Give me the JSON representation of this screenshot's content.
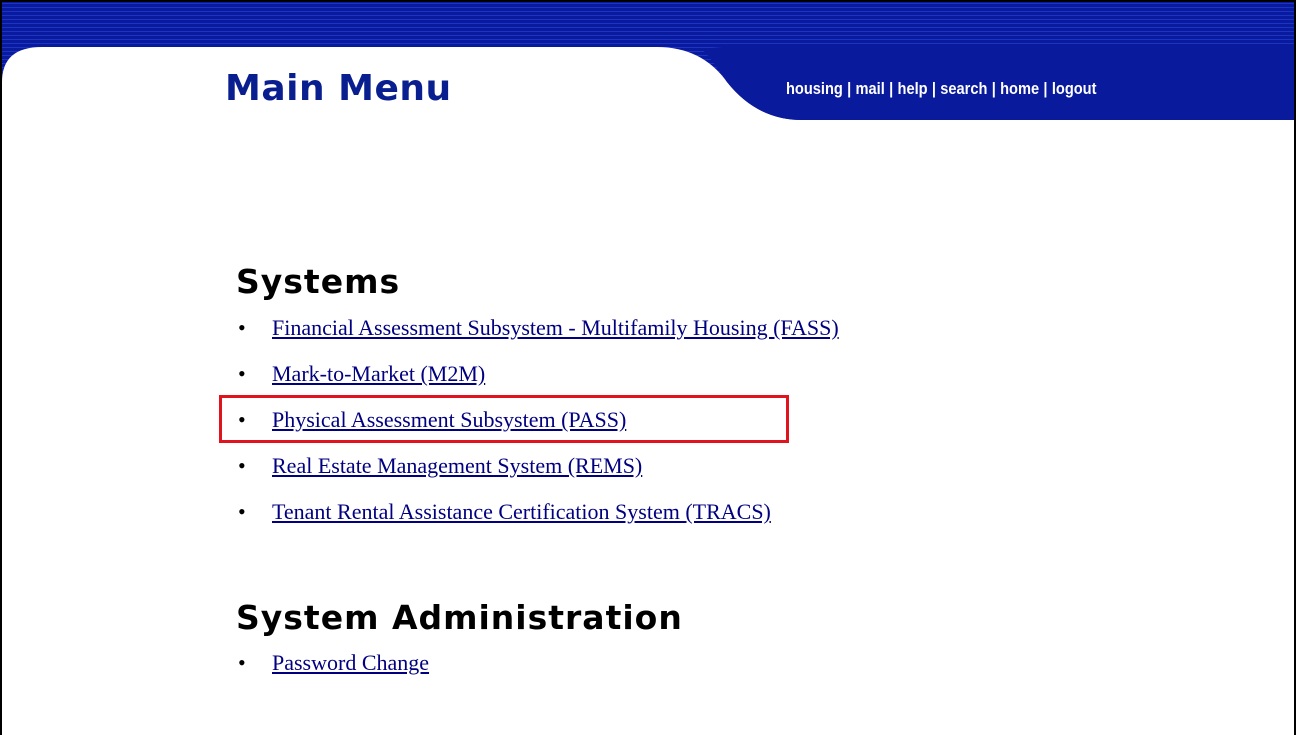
{
  "header": {
    "title": "Main Menu",
    "nav": [
      {
        "label": "housing"
      },
      {
        "label": "mail"
      },
      {
        "label": "help"
      },
      {
        "label": "search"
      },
      {
        "label": "home"
      },
      {
        "label": "logout"
      }
    ],
    "separator": "|",
    "colors": {
      "banner": "#0a1a9c",
      "title": "#0a1f8f",
      "nav_text": "#ffffff"
    }
  },
  "systems": {
    "heading": "Systems",
    "bullet": "•",
    "items": [
      {
        "label": "Financial Assessment Subsystem - Multifamily Housing (FASS)"
      },
      {
        "label": "Mark-to-Market (M2M)"
      },
      {
        "label": "Physical Assessment Subsystem (PASS)",
        "highlighted": true
      },
      {
        "label": "Real Estate Management System (REMS)"
      },
      {
        "label": "Tenant Rental Assistance Certification System (TRACS)"
      }
    ]
  },
  "administration": {
    "heading": "System Administration",
    "items": [
      {
        "label": "Password Change"
      }
    ]
  },
  "colors": {
    "link": "#000080",
    "highlight_border": "#e0141e"
  }
}
